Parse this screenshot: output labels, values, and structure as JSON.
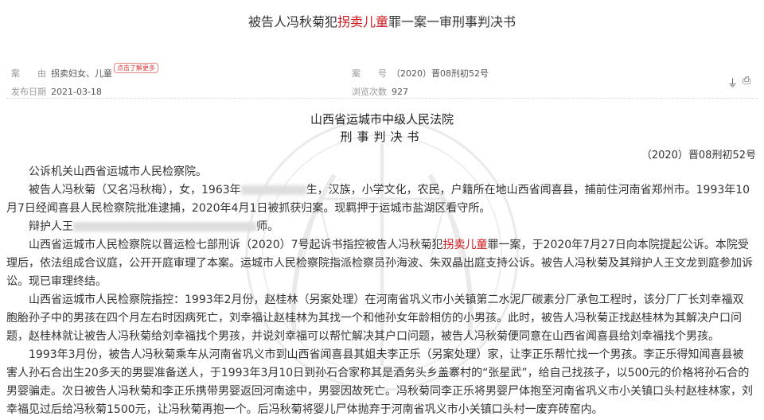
{
  "title": {
    "before": "被告人冯秋菊犯",
    "highlight": "拐卖儿童",
    "after": "罪一案一审刑事判决书"
  },
  "meta": {
    "cause_label": "案　　由",
    "cause_value": "拐卖妇女、儿童",
    "more_badge": "点击了解更多",
    "case_no_label": "案　　号",
    "case_no_value": "（2020）晋08刑初52号",
    "date_label": "发布日期",
    "date_value": "2021-03-18",
    "views_label": "浏览次数",
    "views_value": "927"
  },
  "icons": [
    "download-icon",
    "print-icon"
  ],
  "document": {
    "court": "山西省运城市中级人民法院",
    "doc_type": "刑事判决书",
    "case_no": "（2020）晋08刑初52号",
    "p1": "公诉机关山西省运城市人民检察院。",
    "p2a": "被告人冯秋菊（又名冯秋梅），女，1963年",
    "p2b": "生，汉族，小学文化，农民，户籍所在地山西省闻喜县，捕前住河南省郑州市。1993年10月7日经闻喜县人民检察院批准逮捕，2020年4月1日被抓获归案。现羁押于运城市盐湖区看守所。",
    "p3a": "辩护人王",
    "p3b": "师。",
    "p4a": "山西省运城市人民检察院以晋运检七部刑诉（2020）7号起诉书指控被告人冯秋菊犯",
    "p4h": "拐卖儿童",
    "p4b": "罪一案，于2020年7月27日向本院提起公诉。本院受理后，依法组成合议庭，公开开庭审理了本案。运城市人民检察院指派检察员孙海波、朱双晶出庭支持公诉。被告人冯秋菊及其辩护人王文龙到庭参加诉讼。现已审理终结。",
    "p5": "山西省运城市人民检察院指控：1993年2月份，赵桂林（另案处理）在河南省巩义市小关镇第二水泥厂碳素分厂承包工程时，该分厂厂长刘幸福双胞胎孙子中的男孩在四个月左右时因病死亡，刘幸福让赵桂林为其找一个和他孙女年龄相仿的小男孩。此时，被告人冯秋菊正找赵桂林为其解决户口问题，赵桂林就让被告人冯秋菊给刘幸福找个男孩，并说刘幸福可以帮忙解决其户口问题，被告人冯秋菊便同意在山西省闻喜县给刘幸福找个男孩。",
    "p6": "1993年3月份，被告人冯秋菊乘车从河南省巩义市到山西省闻喜县其姐夫李正乐（另案处理）家，让李正乐帮忙找一个男孩。李正乐得知闻喜县被害人孙石合出生20多天的男婴准备送人，于1993年3月10日到孙石合家称其是酒务头乡盖寨村的“张星武”，给自己找孩子，以500元的价格将孙石合的男婴骗走。次日被告人冯秋菊和李正乐携带男婴返回河南途中，男婴因故死亡。冯秋菊同李正乐将男婴尸体抱至河南省巩义市小关镇口头村赵桂林家，刘幸福见过后给冯秋菊1500元，让冯秋菊再抱一个。后冯秋菊将婴儿尸体抛弃于河南省巩义市小关镇口头村一废弃砖窑内。"
  }
}
